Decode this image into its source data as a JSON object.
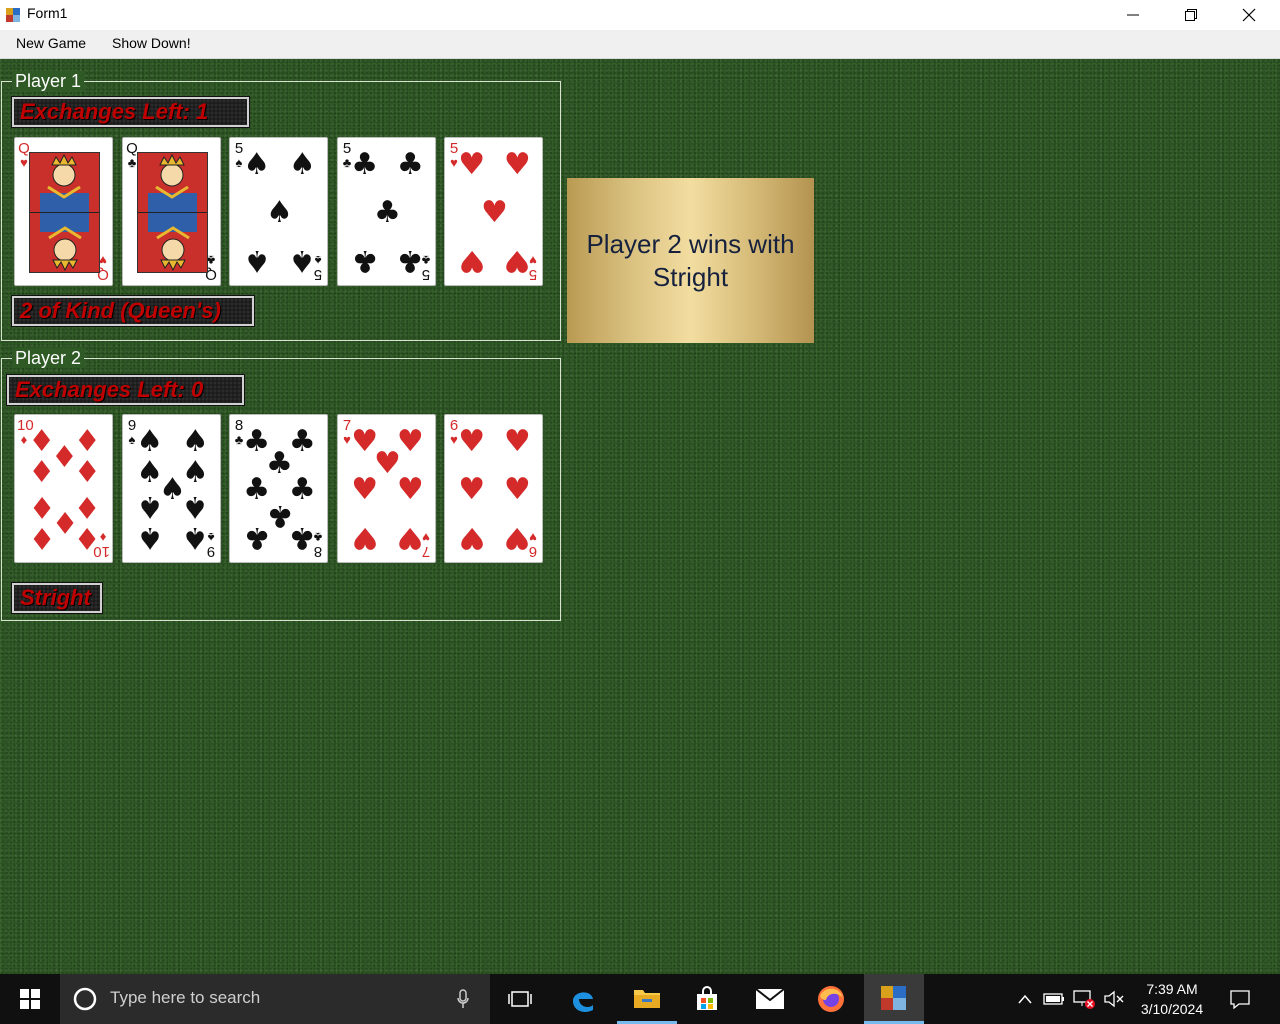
{
  "window": {
    "title": "Form1"
  },
  "menu": {
    "items": [
      "New Game",
      "Show Down!"
    ]
  },
  "players": [
    {
      "title": "Player 1",
      "exchanges": "Exchanges Left:  1",
      "hand_label": "2 of Kind (Queen's)",
      "cards": [
        {
          "rank": "Q",
          "suit": "hearts"
        },
        {
          "rank": "Q",
          "suit": "clubs"
        },
        {
          "rank": "5",
          "suit": "spades"
        },
        {
          "rank": "5",
          "suit": "clubs"
        },
        {
          "rank": "5",
          "suit": "hearts"
        }
      ]
    },
    {
      "title": "Player 2",
      "exchanges": "Exchanges Left:  0",
      "hand_label": "Stright",
      "cards": [
        {
          "rank": "10",
          "suit": "diamonds"
        },
        {
          "rank": "9",
          "suit": "spades"
        },
        {
          "rank": "8",
          "suit": "clubs"
        },
        {
          "rank": "7",
          "suit": "hearts"
        },
        {
          "rank": "6",
          "suit": "hearts"
        }
      ]
    }
  ],
  "result": {
    "text": "Player 2 wins with Stright"
  },
  "taskbar": {
    "search_placeholder": "Type here to search",
    "time": "7:39 AM",
    "date": "3/10/2024"
  },
  "colors": {
    "felt": "#2f5a25",
    "badge_text": "#c00000",
    "plaque": "#e0c685"
  }
}
